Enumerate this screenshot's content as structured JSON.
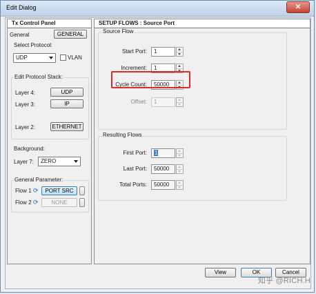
{
  "window": {
    "title": "Edit Dialog",
    "close_label": "✕"
  },
  "left_panel": {
    "header": "Tx Control Panel",
    "general_label": "General",
    "general_button": "GENERAL",
    "select_protocol_label": "Select Protocol:",
    "protocol_value": "UDP",
    "vlan_label": "VLAN",
    "edit_stack_label": "Edit Protocol Stack:",
    "layer4_label": "Layer 4:",
    "layer4_button": "UDP",
    "layer3_label": "Layer 3:",
    "layer3_button": "IP",
    "layer2_label": "Layer 2:",
    "layer2_button": "ETHERNET",
    "background_label": "Background:",
    "layer7_label": "Layer 7:",
    "layer7_value": "ZERO",
    "general_param_label": "General Parameter:",
    "flow1_label": "Flow 1",
    "flow1_button": "PORT SRC",
    "flow2_label": "Flow 2",
    "flow2_button": "NONE"
  },
  "right_panel": {
    "header": "SETUP FLOWS : Source Port",
    "source_flow_label": "Source Flow",
    "start_port_label": "Start Port:",
    "start_port_value": "1",
    "increment_label": "Increment:",
    "increment_value": "1",
    "cycle_count_label": "Cycle Count:",
    "cycle_count_value": "50000",
    "offset_label": "Offset:",
    "offset_value": "1",
    "resulting_flows_label": "Resulting Flows",
    "first_port_label": "First Port:",
    "first_port_value": "1",
    "last_port_label": "Last Port:",
    "last_port_value": "50000",
    "total_ports_label": "Total Ports:",
    "total_ports_value": "50000"
  },
  "buttons": {
    "view": "View",
    "ok": "OK",
    "cancel": "Cancel"
  },
  "watermark": "知乎 @RICH.H"
}
